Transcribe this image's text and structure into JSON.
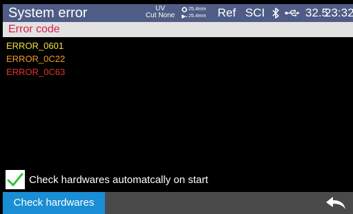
{
  "header": {
    "title": "System error",
    "uv_label": "UV",
    "cut_label": "Cut None",
    "fiber_top": "25.4mm",
    "fiber_bottom": "25.4mm",
    "ref_label": "Ref",
    "sci_label": "SCI",
    "temperature": "32.5",
    "time": "23:32",
    "bg_color": "#4f5d86"
  },
  "section": {
    "label": "Error code",
    "label_color": "#d61f4e"
  },
  "errors": [
    {
      "code": "ERROR_0601",
      "color": "#f4e33a"
    },
    {
      "code": "ERROR_0C22",
      "color": "#f39a2b"
    },
    {
      "code": "ERROR_0C63",
      "color": "#e3342b"
    }
  ],
  "auto_check": {
    "label": "Check hardwares automatcally on start",
    "checked": true,
    "check_color": "#34c23a"
  },
  "toolbar": {
    "check_button_label": "Check hardwares",
    "back_icon": "back-arrow-icon",
    "button_color": "#1a8ed4"
  },
  "icons": {
    "bluetooth": "bluetooth-icon",
    "usb": "usb-icon",
    "fiber": "fiber-icon"
  }
}
